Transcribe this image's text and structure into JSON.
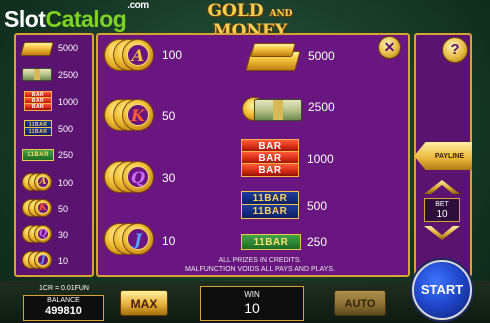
{
  "watermark": {
    "slot": "Slot",
    "catalog": "Catalog",
    "com": ".com"
  },
  "game_title": {
    "part1": "GOLD",
    "and": "AND",
    "part2": "MONEY"
  },
  "left_column": [
    {
      "symbol": "gold-coins",
      "value": "5000"
    },
    {
      "symbol": "cash",
      "value": "2500"
    },
    {
      "symbol": "triple-bar",
      "value": "1000"
    },
    {
      "symbol": "double-bar",
      "value": "500"
    },
    {
      "symbol": "single-bar",
      "value": "250"
    },
    {
      "symbol": "coin-a",
      "value": "100"
    },
    {
      "symbol": "coin-k",
      "value": "50"
    },
    {
      "symbol": "coin-q",
      "value": "30"
    },
    {
      "symbol": "coin-j",
      "value": "10"
    }
  ],
  "paytable": {
    "coin_a": {
      "letter": "A",
      "value": "100"
    },
    "coin_k": {
      "letter": "K",
      "value": "50"
    },
    "coin_q": {
      "letter": "Q",
      "value": "30"
    },
    "coin_j": {
      "letter": "J",
      "value": "10"
    },
    "gold": {
      "value": "5000"
    },
    "cash": {
      "value": "2500"
    },
    "triple_bar": {
      "label": "BAR",
      "value": "1000"
    },
    "double_bar": {
      "label": "BAR",
      "prefix": "11",
      "value": "500"
    },
    "single_bar": {
      "label": "BAR",
      "prefix": "11",
      "value": "250"
    }
  },
  "notes": {
    "line1": "ALL PRIZES IN CREDITS.",
    "line2": "MALFUNCTION VOIDS ALL PAYS AND PLAYS."
  },
  "controls": {
    "close_symbol": "✕",
    "help_symbol": "?",
    "payline_label": "PAYLINE",
    "bet_label": "BET",
    "bet_value": "10",
    "cr_label": "1CR = 0.01FUN",
    "balance_label": "BALANCE",
    "balance_value": "499810",
    "max_label": "MAX",
    "win_label": "WIN",
    "win_value": "10",
    "auto_label": "AUTO",
    "start_label": "START"
  },
  "colors": {
    "panel": "#6a1681",
    "border": "#d9a234",
    "accent": "#f6cf54"
  }
}
